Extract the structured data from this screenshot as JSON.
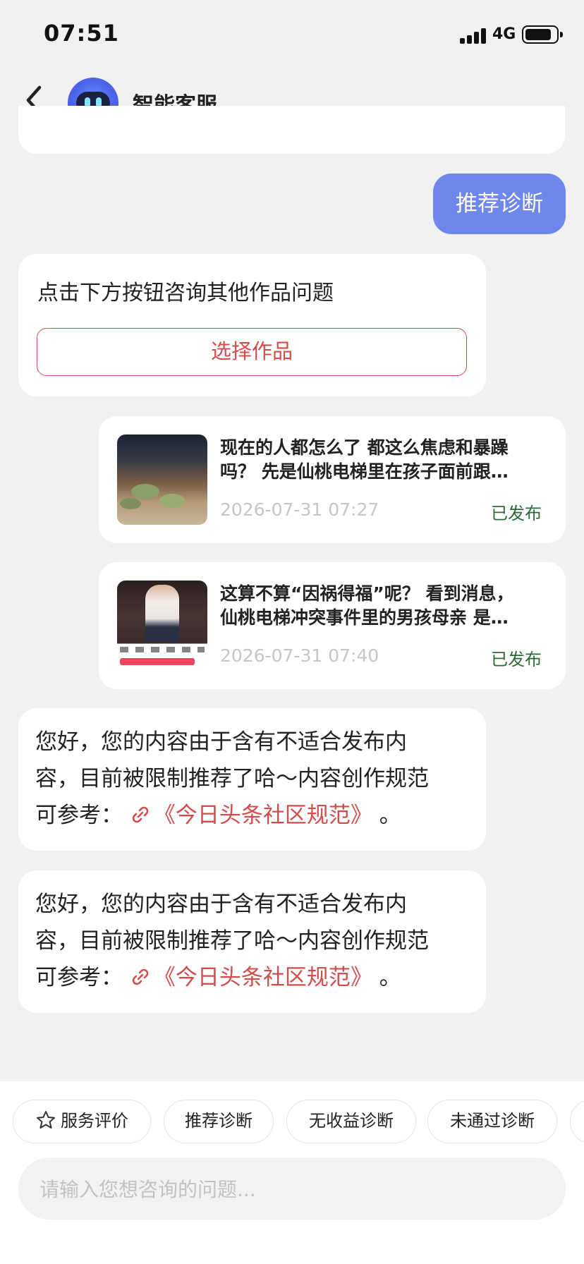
{
  "status_bar": {
    "time": "07:51",
    "network": "4G"
  },
  "header": {
    "back_icon": "chevron-left-icon",
    "avatar_icon": "robot-icon",
    "title": "智能客服"
  },
  "chat": {
    "user_message": "推荐诊断",
    "prompt_card": {
      "text": "点击下方按钮咨询其他作品问题",
      "button_label": "选择作品"
    },
    "works": [
      {
        "title_line1": "现在的人都怎么了 都这么焦虑和暴躁",
        "title_line2": "吗？ 先是仙桃电梯里在孩子面前跟…",
        "date": "2026-07-31 07:27",
        "status": "已发布"
      },
      {
        "title_line1": "这算不算“因祸得福”呢？ 看到消息，",
        "title_line2": "仙桃电梯冲突事件里的男孩母亲 是…",
        "date": "2026-07-31 07:40",
        "status": "已发布"
      }
    ],
    "messages": [
      {
        "line1": "您好，您的内容由于含有不适合发布内",
        "line2": "容，目前被限制推荐了哈～内容创作规范",
        "line3_prefix": "可参考：",
        "link_text": "《今日头条社区规范》",
        "line3_suffix": "。"
      },
      {
        "line1": "您好，您的内容由于含有不适合发布内",
        "line2": "容，目前被限制推荐了哈～内容创作规范",
        "line3_prefix": "可参考：",
        "link_text": "《今日头条社区规范》",
        "line3_suffix": "。"
      }
    ]
  },
  "quick_actions": {
    "items": [
      {
        "label": "服务评价",
        "icon": "star-icon"
      },
      {
        "label": "推荐诊断"
      },
      {
        "label": "无收益诊断"
      },
      {
        "label": "未通过诊断"
      }
    ]
  },
  "input": {
    "placeholder": "请输入您想咨询的问题...",
    "value": ""
  },
  "colors": {
    "accent": "#6f86ea",
    "link": "#d24c4c",
    "published": "#2f6a35",
    "background": "#f1f1f3"
  }
}
